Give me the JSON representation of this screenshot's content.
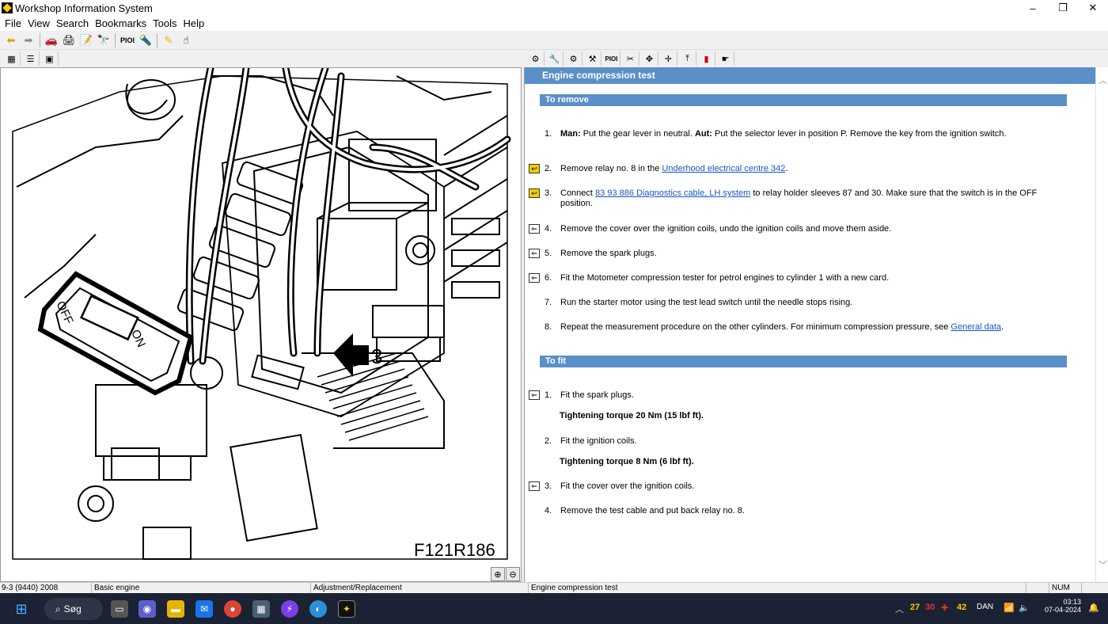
{
  "window": {
    "title": "Workshop Information System",
    "minimize": "–",
    "maximize": "❐",
    "close": "✕"
  },
  "menu": [
    "File",
    "View",
    "Search",
    "Bookmarks",
    "Tools",
    "Help"
  ],
  "toolbar": {
    "pio_label": "PIOI"
  },
  "subtoolbar_right": {
    "pio_label": "PIOI"
  },
  "image_pane": {
    "figure_label": "F121R186",
    "callout": "3",
    "switch_off": "OFF",
    "switch_on": "ON"
  },
  "document": {
    "title": "Engine compression test",
    "remove_header": "To remove",
    "remove_steps": [
      {
        "num": "1.",
        "prefix_bold": "Man:",
        "text1": " Put the gear lever in neutral. ",
        "bold2": "Aut:",
        "text2": " Put the selector lever in position P. Remove the key from the ignition switch."
      },
      {
        "num": "2.",
        "before": "Remove relay no. 8 in the ",
        "link": "Underhood electrical centre 342",
        "after": "."
      },
      {
        "num": "3.",
        "before": "Connect ",
        "link": "83 93 886 Diagnostics cable, LH system",
        "after": " to relay holder sleeves 87 and 30. Make sure that the switch is in the OFF position."
      },
      {
        "num": "4.",
        "text": "Remove the cover over the ignition coils, undo the ignition coils and move them aside."
      },
      {
        "num": "5.",
        "text": "Remove the spark plugs."
      },
      {
        "num": "6.",
        "text": "Fit the Motometer compression tester for petrol engines to cylinder 1 with a new card."
      },
      {
        "num": "7.",
        "text": "Run the starter motor using the test lead switch until the needle stops rising."
      },
      {
        "num": "8.",
        "before": "Repeat the measurement procedure on the other cylinders. For minimum compression pressure, see ",
        "link": "General data",
        "after": "."
      }
    ],
    "fit_header": "To fit",
    "fit_steps": [
      {
        "num": "1.",
        "text": "Fit the spark plugs."
      },
      {
        "num": "2.",
        "text": "Fit the ignition coils."
      },
      {
        "num": "3.",
        "text": "Fit the cover over the ignition coils."
      },
      {
        "num": "4.",
        "text": "Remove the test cable and put back relay no. 8."
      }
    ],
    "torque1": "Tightening torque 20 Nm (15 lbf ft).",
    "torque2": "Tightening torque 8 Nm (6 lbf ft)."
  },
  "status": {
    "model": "9-3 (9440) 2008",
    "group": "Basic engine",
    "category": "Adjustment/Replacement",
    "doc": "Engine compression test",
    "num": "NUM"
  },
  "taskbar": {
    "search": "Søg",
    "temp1": "27",
    "temp2": "30",
    "temp3": "42",
    "lang": "DAN",
    "time": "03:13",
    "date": "07-04-2024"
  }
}
